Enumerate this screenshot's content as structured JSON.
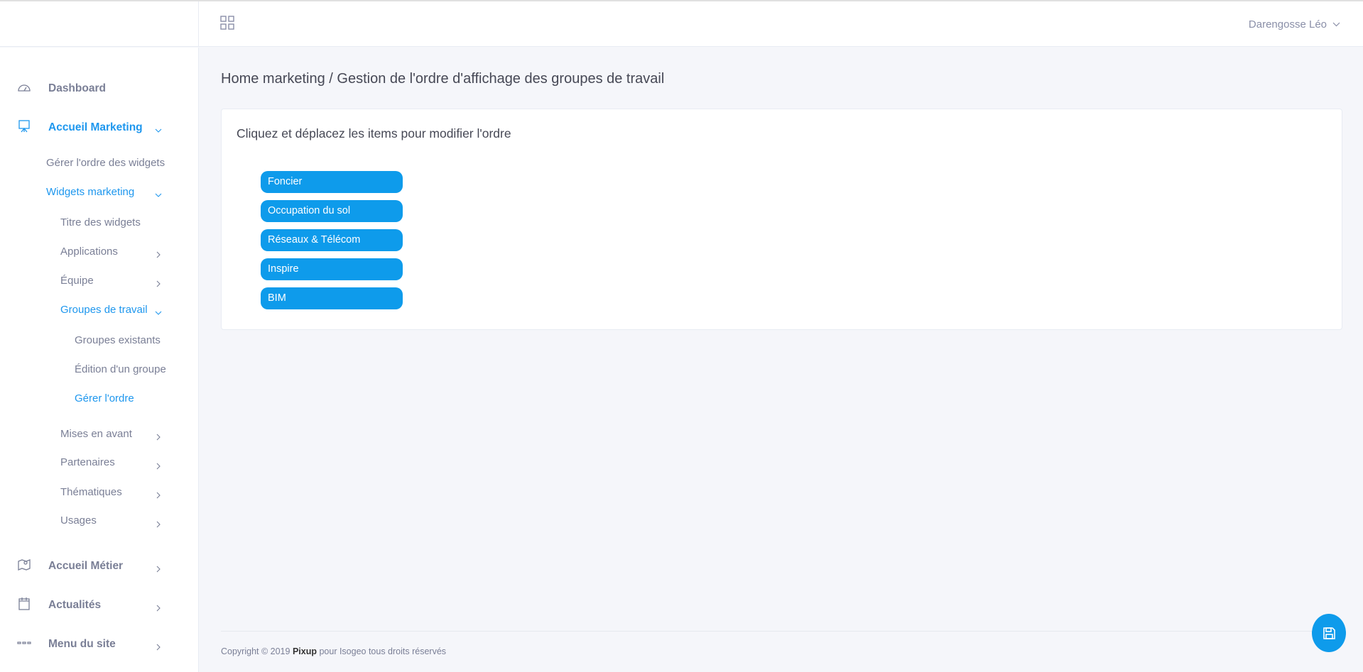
{
  "header": {
    "user_name": "Darengosse Léo"
  },
  "sidebar": {
    "dashboard": "Dashboard",
    "accueil_marketing": "Accueil Marketing",
    "gerer_widgets": "Gérer l'ordre des widgets",
    "widgets_marketing": "Widgets marketing",
    "titre_widgets": "Titre des widgets",
    "applications": "Applications",
    "equipe": "Équipe",
    "groupes_travail": "Groupes de travail",
    "groupes_existants": "Groupes existants",
    "edition_groupe": "Édition d'un groupe",
    "gerer_ordre": "Gérer l'ordre",
    "mises_en_avant": "Mises en avant",
    "partenaires": "Partenaires",
    "thematiques": "Thématiques",
    "usages": "Usages",
    "accueil_metier": "Accueil Métier",
    "actualites": "Actualités",
    "menu_site": "Menu du site"
  },
  "main": {
    "breadcrumb": "Home marketing / Gestion de l'ordre d'affichage des groupes de travail",
    "card_title": "Cliquez et déplacez les items pour modifier l'ordre",
    "items": [
      "Foncier",
      "Occupation du sol",
      "Réseaux & Télécom",
      "Inspire",
      "BIM"
    ]
  },
  "footer": {
    "prefix": "Copyright © 2019 ",
    "brand": "Pixup",
    "suffix": " pour Isogeo tous droits réservés"
  },
  "colors": {
    "accent": "#0e9beb",
    "active_nav": "#1e97ee"
  },
  "icons": {
    "save": "floppy-disk-icon",
    "apps": "grid-icon"
  }
}
